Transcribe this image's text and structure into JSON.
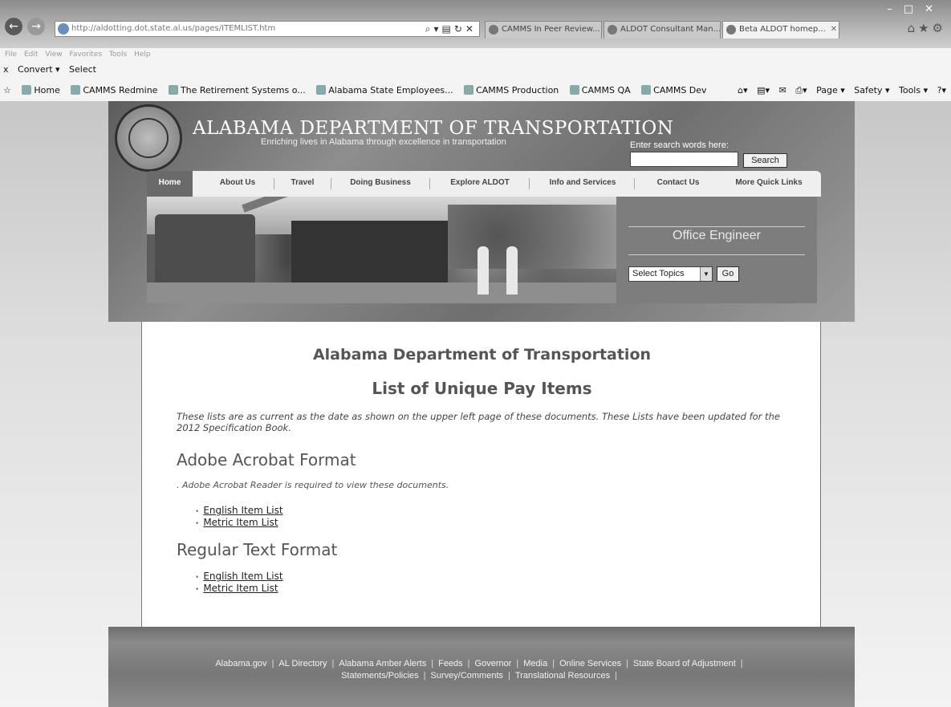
{
  "browser": {
    "url": "http://aldotting.dot.state.al.us/pages/ITEMLIST.htm",
    "tabs": [
      {
        "label": "CAMMS In Peer Review..."
      },
      {
        "label": "ALDOT Consultant Man..."
      },
      {
        "label": "Beta ALDOT homep..."
      }
    ],
    "menu": [
      "File",
      "Edit",
      "View",
      "Favorites",
      "Tools",
      "Help"
    ],
    "commands": [
      "x",
      "Convert ▾",
      "Select"
    ],
    "favorites": [
      "Home",
      "CAMMS Redmine",
      "The Retirement Systems o...",
      "Alabama State Employees...",
      "CAMMS Production",
      "CAMMS QA",
      "CAMMS Dev"
    ],
    "tools": [
      "Page ▾",
      "Safety ▾",
      "Tools ▾"
    ]
  },
  "header": {
    "title": "ALABAMA DEPARTMENT OF TRANSPORTATION",
    "tagline": "Enriching lives in Alabama through excellence in transportation",
    "search_label": "Enter search words here:",
    "search_button": "Search"
  },
  "nav": [
    {
      "label": "Home"
    },
    {
      "label": "About Us"
    },
    {
      "label": "Travel"
    },
    {
      "label": "Doing Business"
    },
    {
      "label": "Explore ALDOT"
    },
    {
      "label": "Info and Services"
    },
    {
      "label": "Contact Us"
    },
    {
      "label": "More Quick Links"
    }
  ],
  "office": {
    "title": "Office Engineer",
    "select_value": "Select Topics",
    "go_label": "Go"
  },
  "content": {
    "heading1": "Alabama Department of Transportation",
    "heading2": "List of Unique Pay Items",
    "intro": "These lists are as current as the date as shown on the upper left page of these documents.  These Lists have been updated for the 2012 Specification Book.",
    "section1": {
      "title": "Adobe Acrobat Format",
      "note": ". Adobe Acrobat Reader is required to view these documents.",
      "links": [
        "English Item List",
        "Metric Item List"
      ]
    },
    "section2": {
      "title": "Regular Text Format",
      "links": [
        "English Item List",
        "Metric Item List"
      ]
    }
  },
  "footer": {
    "row1": [
      "Alabama.gov",
      "AL Directory",
      "Alabama Amber Alerts",
      "Feeds",
      "Governor",
      "Media",
      "Online Services",
      "State Board of Adjustment"
    ],
    "row2": [
      "Statements/Policies",
      "Survey/Comments",
      "Translational Resources"
    ]
  }
}
